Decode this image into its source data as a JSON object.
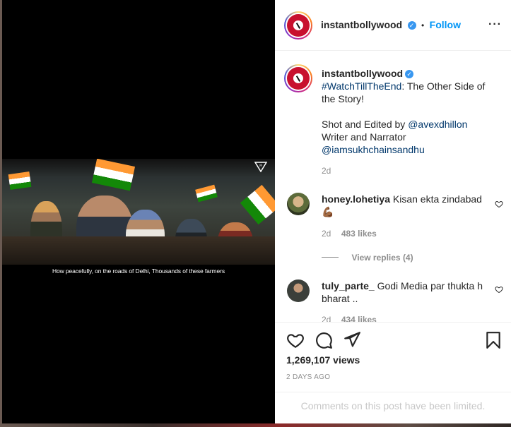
{
  "post": {
    "username": "instantbollywood",
    "follow_label": "Follow",
    "more_icon": "more-horizontal-icon",
    "video_caption": "How peacefully, on the roads of Delhi, Thousands of these farmers"
  },
  "caption": {
    "username": "instantbollywood",
    "hashtag": "#WatchTillTheEnd",
    "text_after_hashtag": ": The Other Side of the Story!",
    "shot_prefix": "Shot and Edited by ",
    "shot_by": "@avexdhillon",
    "writer_prefix": "Writer and Narrator",
    "writer": "@iamsukhchainsandhu",
    "age": "2d"
  },
  "comments": [
    {
      "username": "honey.lohetiya",
      "text": "Kisan ekta zindabad 💪🏾",
      "age": "2d",
      "likes": "483 likes",
      "view_replies": "View replies (4)"
    },
    {
      "username": "tuly_parte_",
      "text": "Godi Media par thukta h bharat ..",
      "age": "2d",
      "likes": "434 likes"
    }
  ],
  "actions": {
    "views": "1,269,107 views",
    "date": "2 DAYS AGO",
    "comments_limited": "Comments on this post have been limited."
  },
  "colors": {
    "link": "#00376b",
    "follow": "#0095f6",
    "verified": "#3897f0",
    "meta": "#8e8e8e"
  }
}
